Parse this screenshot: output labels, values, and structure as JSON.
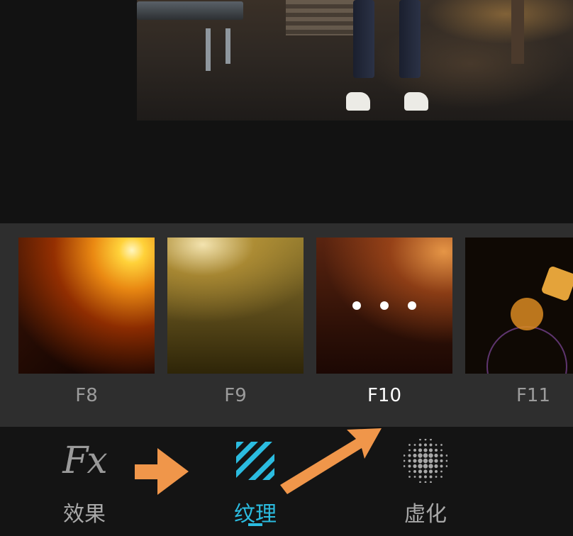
{
  "filters": [
    {
      "id": "f8",
      "label": "F8"
    },
    {
      "id": "f9",
      "label": "F9"
    },
    {
      "id": "f10",
      "label": "F10",
      "selected": true
    },
    {
      "id": "f11",
      "label": "F11"
    }
  ],
  "tabs": [
    {
      "id": "effects",
      "icon": "fx-icon",
      "icon_text": "Fx",
      "label": "效果"
    },
    {
      "id": "texture",
      "icon": "diagonal-stripes-icon",
      "label": "纹理",
      "active": true
    },
    {
      "id": "blur",
      "icon": "dot-grid-icon",
      "label": "虚化"
    }
  ],
  "colors": {
    "accent": "#2bbce0",
    "annotation_arrow": "#f0964a",
    "strip_background": "#2e2e2e",
    "bar_background": "#141414"
  }
}
